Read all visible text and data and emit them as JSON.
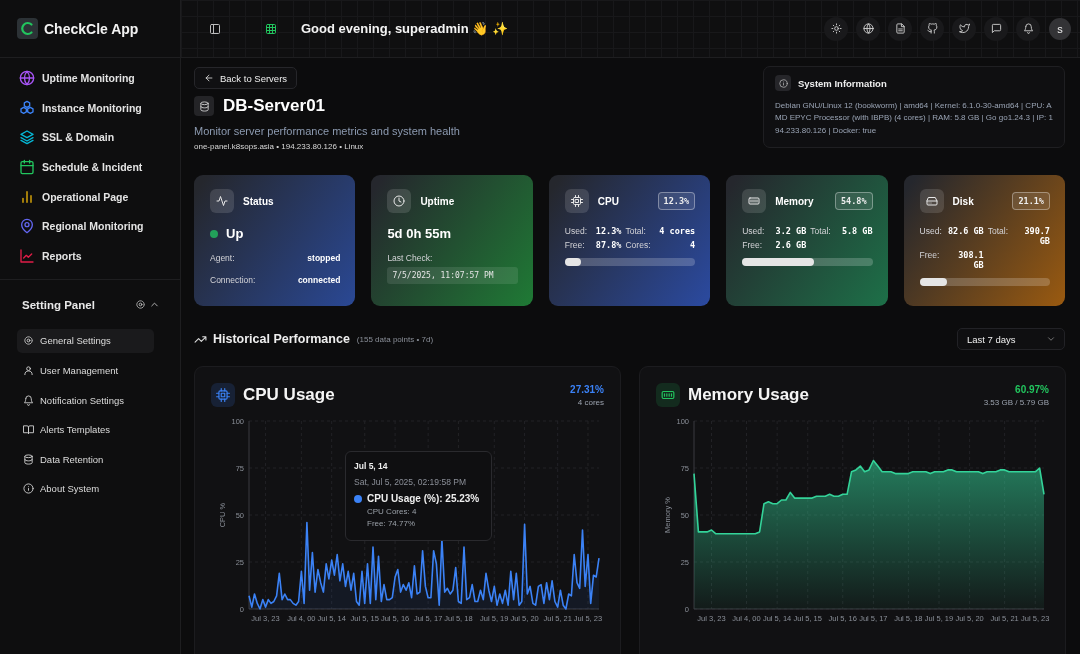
{
  "sidebar": {
    "app_name": "CheckCle App",
    "nav": [
      {
        "label": "Uptime Monitoring",
        "selected": false
      },
      {
        "label": "Instance Monitoring",
        "selected": false
      },
      {
        "label": "SSL & Domain",
        "selected": false
      },
      {
        "label": "Schedule & Incident",
        "selected": false
      },
      {
        "label": "Operational Page",
        "selected": false
      },
      {
        "label": "Regional Monitoring",
        "selected": false
      },
      {
        "label": "Reports",
        "selected": false
      }
    ],
    "settings": {
      "title": "Setting Panel",
      "expanded": true,
      "items": [
        {
          "label": "General Settings",
          "selected": true
        },
        {
          "label": "User Management",
          "selected": false
        },
        {
          "label": "Notification Settings",
          "selected": false
        },
        {
          "label": "Alerts Templates",
          "selected": false
        },
        {
          "label": "Data Retention",
          "selected": false
        },
        {
          "label": "About System",
          "selected": false
        }
      ]
    }
  },
  "header": {
    "greeting": "Good evening, superadmin 👋 ✨",
    "avatar": "s"
  },
  "server": {
    "back": "Back to Servers",
    "name": "DB-Server01",
    "description": "Monitor server performance metrics and system health",
    "meta": "one-panel.k8sops.asia • 194.233.80.126 • Linux"
  },
  "system_info": {
    "title": "System Information",
    "text": "Debian GNU/Linux 12 (bookworm) | amd64 | Kernel: 6.1.0-30-amd64 | CPU: AMD EPYC Processor (with IBPB) (4 cores) | RAM: 5.8 GB | Go go1.24.3 | IP: 194.233.80.126 | Docker: true"
  },
  "cards": [
    {
      "kind": "status",
      "title": "Status",
      "color": "#2a4894",
      "status": {
        "label": "Up",
        "color": "#22a05a"
      },
      "rows": [
        {
          "label": "Agent:",
          "value": "stopped"
        },
        {
          "label": "Connection:",
          "value": "connected"
        }
      ]
    },
    {
      "kind": "uptime",
      "title": "Uptime",
      "color": "#1f7a35",
      "value": "5d 0h 55m",
      "label": "Last Check:",
      "timestamp": "7/5/2025, 11:07:57 PM"
    },
    {
      "kind": "metric",
      "title": "CPU",
      "color": "#2b4aa0",
      "badge": "12.3%",
      "stats": [
        {
          "label": "Used:",
          "value": "12.3%"
        },
        {
          "label": "Total:",
          "value": "4 cores"
        },
        {
          "label": "Free:",
          "value": "87.8%"
        },
        {
          "label": "Cores:",
          "value": "4"
        }
      ],
      "level": 0.123
    },
    {
      "kind": "metric",
      "title": "Memory",
      "color": "#1d7048",
      "badge": "54.8%",
      "stats": [
        {
          "label": "Used:",
          "value": "3.2 GB"
        },
        {
          "label": "Total:",
          "value": "5.8 GB"
        },
        {
          "label": "Free:",
          "value": "2.6 GB"
        }
      ],
      "level": 0.548
    },
    {
      "kind": "metric",
      "title": "Disk",
      "color": "#9a5a10",
      "badge": "21.1%",
      "stats": [
        {
          "label": "Used:",
          "value": "82.6 GB"
        },
        {
          "label": "Total:",
          "value": "390.7 GB"
        },
        {
          "label": "Free:",
          "value": "308.1 GB"
        }
      ],
      "level": 0.211
    }
  ],
  "performance": {
    "title": "Historical Performance",
    "subtitle": "(155 data points • 7d)",
    "range": "Last 7 days",
    "charts": [
      {
        "title": "CPU Usage",
        "value": "27.31%",
        "subtitle": "4 cores",
        "color": "#3b82f6",
        "chart_data": {
          "type": "line",
          "ylabel": "CPU %",
          "ylim": [
            0,
            100
          ],
          "yticks": [
            0,
            25,
            50,
            75,
            100
          ],
          "grid": true,
          "categories": [
            null,
            null,
            null,
            null,
            null,
            null,
            "Jul 3, 23",
            null,
            null,
            null,
            null,
            null,
            null,
            null,
            null,
            null,
            null,
            null,
            null,
            "Jul 4, 00",
            null,
            null,
            null,
            null,
            null,
            null,
            null,
            null,
            null,
            null,
            "Jul 5, 14",
            null,
            null,
            null,
            null,
            null,
            null,
            null,
            null,
            null,
            null,
            null,
            "Jul 5, 15",
            null,
            null,
            null,
            null,
            null,
            null,
            null,
            null,
            null,
            null,
            "Jul 5, 16",
            null,
            null,
            null,
            null,
            null,
            null,
            null,
            null,
            null,
            null,
            null,
            "Jul 5, 17",
            null,
            null,
            null,
            null,
            null,
            null,
            null,
            null,
            null,
            null,
            "Jul 5, 18",
            null,
            null,
            null,
            null,
            null,
            null,
            null,
            null,
            null,
            null,
            null,
            null,
            "Jul 5, 19",
            null,
            null,
            null,
            null,
            null,
            null,
            null,
            null,
            null,
            null,
            "Jul 5, 20",
            null,
            null,
            null,
            null,
            null,
            null,
            null,
            null,
            null,
            null,
            null,
            "Jul 5, 21",
            null,
            null,
            null,
            null,
            null,
            null,
            null,
            null,
            null,
            null,
            "Jul 5, 23",
            null,
            null,
            null,
            null
          ],
          "series": [
            {
              "color": "#3b82f6",
              "values": [
                7,
                1,
                8,
                3,
                0,
                5,
                1,
                5,
                3,
                4,
                7,
                19,
                5,
                8,
                5,
                5,
                3,
                2,
                4,
                20,
                3,
                46,
                10,
                30,
                9,
                21,
                14,
                9,
                24,
                16,
                26,
                18,
                29,
                15,
                24,
                12,
                20,
                10,
                19,
                4,
                2,
                20,
                3,
                24,
                3,
                33,
                5,
                28,
                4,
                13,
                5,
                5,
                6,
                17,
                21,
                9,
                13,
                10,
                14,
                6,
                23,
                8,
                9,
                31,
                12,
                6,
                6,
                31,
                24,
                2,
                37,
                9,
                11,
                8,
                10,
                22,
                4,
                3,
                33,
                5,
                6,
                13,
                4,
                4,
                10,
                5,
                19,
                10,
                4,
                12,
                2,
                8,
                3,
                10,
                2,
                20,
                5,
                19,
                2,
                4,
                45,
                8,
                12,
                3,
                2,
                12,
                13,
                3,
                14,
                5,
                15,
                4,
                1,
                10,
                2,
                0,
                8,
                7,
                29,
                14,
                11,
                42,
                12,
                29,
                3,
                18,
                17,
                27
              ]
            }
          ]
        },
        "tooltip": {
          "title": "Jul 5, 14",
          "datetime": "Sat, Jul 5, 2025, 02:19:58 PM",
          "series": "CPU Usage (%): 25.23%",
          "color": "#3b82f6",
          "lines": [
            "CPU Cores: 4",
            "Free: 74.77%"
          ]
        }
      },
      {
        "title": "Memory Usage",
        "value": "60.97%",
        "subtitle": "3.53 GB / 5.79 GB",
        "color": "#22c55e",
        "chart_data": {
          "type": "area",
          "ylabel": "Memory %",
          "ylim": [
            0,
            100
          ],
          "yticks": [
            0,
            25,
            50,
            75,
            100
          ],
          "grid": true,
          "categories": [
            null,
            null,
            null,
            null,
            "Jul 3, 23",
            null,
            null,
            null,
            null,
            null,
            null,
            null,
            "Jul 4, 00",
            null,
            null,
            null,
            null,
            null,
            null,
            "Jul 5, 14",
            null,
            null,
            null,
            null,
            null,
            null,
            "Jul 5, 15",
            null,
            null,
            null,
            null,
            null,
            null,
            null,
            "Jul 5, 16",
            null,
            null,
            null,
            null,
            null,
            null,
            "Jul 5, 17",
            null,
            null,
            null,
            null,
            null,
            null,
            null,
            "Jul 5, 18",
            null,
            null,
            null,
            null,
            null,
            null,
            "Jul 5, 19",
            null,
            null,
            null,
            null,
            null,
            null,
            "Jul 5, 20",
            null,
            null,
            null,
            null,
            null,
            null,
            null,
            "Jul 5, 21",
            null,
            null,
            null,
            null,
            null,
            null,
            "Jul 5, 23",
            null,
            null
          ],
          "series": [
            {
              "color": "#34d399",
              "values": [
                72,
                41,
                41,
                41,
                42,
                40,
                40,
                40,
                40,
                40,
                40,
                40,
                40,
                40,
                40,
                41,
                56,
                57,
                56,
                56,
                58,
                58,
                62,
                59,
                59,
                59,
                59,
                59,
                60,
                60,
                60,
                61,
                60,
                60,
                61,
                61,
                73,
                74,
                76,
                73,
                74,
                79,
                76,
                73,
                73,
                73,
                72,
                72,
                72,
                72,
                73,
                73,
                73,
                73,
                72,
                73,
                73,
                73,
                74,
                74,
                73,
                73,
                73,
                73,
                73,
                73,
                72,
                73,
                73,
                73,
                74,
                74,
                73,
                73,
                73,
                73,
                73,
                73,
                73,
                75,
                61
              ]
            }
          ]
        }
      }
    ]
  }
}
